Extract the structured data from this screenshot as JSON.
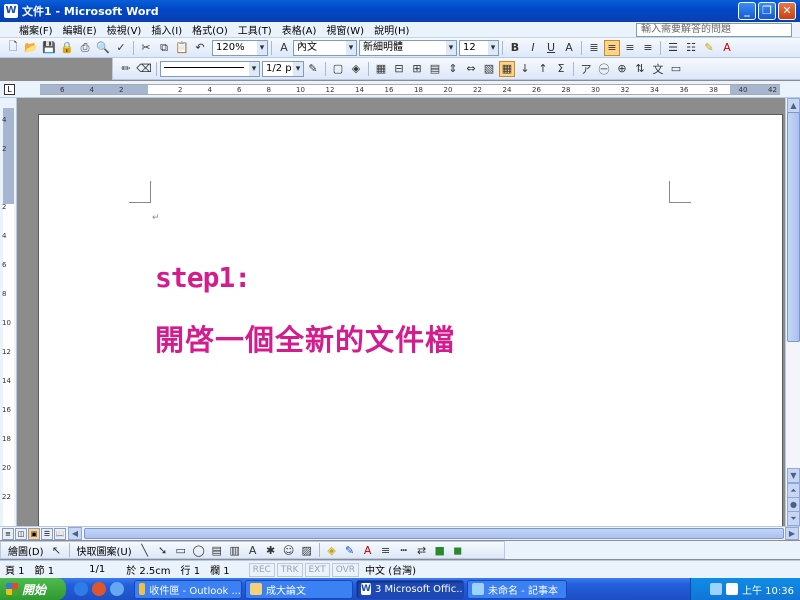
{
  "window": {
    "title": "文件1 - Microsoft Word",
    "app_icon": "W"
  },
  "menu": {
    "items": [
      "檔案(F)",
      "編輯(E)",
      "檢視(V)",
      "插入(I)",
      "格式(O)",
      "工具(T)",
      "表格(A)",
      "視窗(W)",
      "說明(H)"
    ],
    "help_placeholder": "輸入需要解答的問題"
  },
  "toolbar": {
    "zoom": "120%",
    "style": "內文",
    "font": "新細明體",
    "size": "12",
    "line_width": "1/2 p"
  },
  "ruler": {
    "h_ticks": [
      "6",
      "4",
      "2",
      "",
      "2",
      "4",
      "6",
      "8",
      "10",
      "12",
      "14",
      "16",
      "18",
      "20",
      "22",
      "24",
      "26",
      "28",
      "30",
      "32",
      "34",
      "36",
      "38",
      "40",
      "42"
    ],
    "v_ticks": [
      "4",
      "2",
      "",
      "2",
      "4",
      "6",
      "8",
      "10",
      "12",
      "14",
      "16",
      "18",
      "20",
      "22"
    ]
  },
  "document": {
    "para_mark": "↵",
    "heading": "step1:",
    "body": "開啓一個全新的文件檔"
  },
  "drawbar": {
    "draw_label": "繪圖(D)",
    "autoshape_label": "快取圖案(U)"
  },
  "status": {
    "page": "頁 1",
    "section": "節 1",
    "pages": "1/1",
    "at": "於 2.5cm",
    "line": "行 1",
    "col": "欄 1",
    "rec": "REC",
    "trk": "TRK",
    "ext": "EXT",
    "ovr": "OVR",
    "lang": "中文 (台灣)"
  },
  "taskbar": {
    "start": "開始",
    "tasks": [
      "收件匣 - Outlook ...",
      "成大論文",
      "3 Microsoft Offic...",
      "未命名 - 記事本"
    ],
    "clock": "上午 10:36"
  }
}
